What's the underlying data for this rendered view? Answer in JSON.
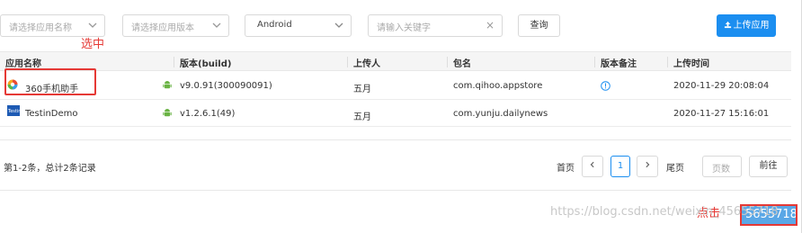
{
  "filters": {
    "app_name_placeholder": "请选择应用名称",
    "app_version_placeholder": "请选择应用版本",
    "platform_value": "Android",
    "keyword_placeholder": "请输入关键字",
    "search_label": "查询",
    "upload_label": "上传应用"
  },
  "annotations": {
    "select_label": "选中",
    "click_label": "点击"
  },
  "table": {
    "headers": [
      "应用名称",
      "版本(build)",
      "上传人",
      "包名",
      "版本备注",
      "上传时间"
    ],
    "rows": [
      {
        "app_name": "360手机助手",
        "version": "v9.0.91(300090091)",
        "uploader": "五月",
        "package": "com.qihoo.appstore",
        "upload_time": "2020-11-29 20:08:04",
        "has_note": true
      },
      {
        "app_name": "TestinDemo",
        "version": "v1.2.6.1(49)",
        "uploader": "五月",
        "package": "com.yunju.dailynews",
        "upload_time": "2020-11-27 15:16:01",
        "has_note": false
      }
    ]
  },
  "pagination": {
    "summary": "第1-2条，总计2条记录",
    "first_label": "首页",
    "current_page": "1",
    "last_label": "尾页",
    "page_count_label": "页数",
    "go_label": "前往"
  },
  "footer": {
    "watermark": "https://blog.csdn.net/weixin_45655718",
    "partial_button": "5655718"
  },
  "colors": {
    "primary": "#1b8ef0",
    "annotation": "#e53935",
    "android": "#6ab344"
  }
}
